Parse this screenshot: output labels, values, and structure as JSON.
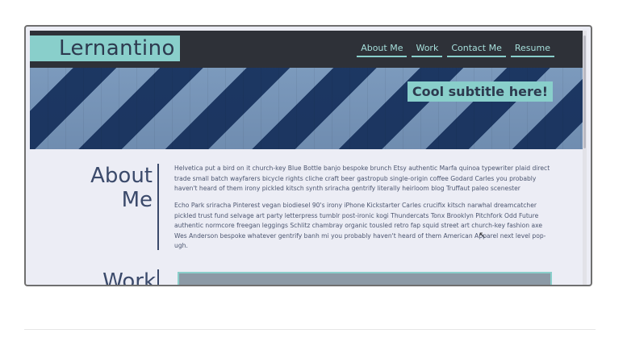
{
  "site": {
    "logo": "Lernantino",
    "nav": [
      "About Me",
      "Work",
      "Contact Me",
      "Resume"
    ],
    "subtitle": "Cool subtitle here!"
  },
  "about": {
    "title_line1": "About",
    "title_line2": "Me",
    "paragraph1": "Helvetica put a bird on it church-key Blue Bottle banjo bespoke brunch Etsy authentic Marfa quinoa typewriter plaid direct trade small batch wayfarers bicycle rights cliche craft beer gastropub single-origin coffee Godard Carles you probably haven't heard of them irony pickled kitsch synth sriracha gentrify literally heirloom blog Truffaut paleo scenester",
    "paragraph2": "Echo Park sriracha Pinterest vegan biodiesel 90's irony iPhone Kickstarter Carles crucifix kitsch narwhal dreamcatcher pickled trust fund selvage art party letterpress tumblr post-ironic kogi Thundercats Tonx Brooklyn Pitchfork Odd Future authentic normcore freegan leggings Schlitz chambray organic tousled retro fap squid street art church-key fashion axe Wes Anderson bespoke whatever gentrify banh mi you probably haven't heard of them American Apparel next level pop-ugh."
  },
  "work": {
    "title": "Work"
  },
  "colors": {
    "accent": "#89cfcb",
    "header_bg": "#2e3138",
    "title_color": "#3b4a6b",
    "page_bg": "#ecedf5"
  }
}
